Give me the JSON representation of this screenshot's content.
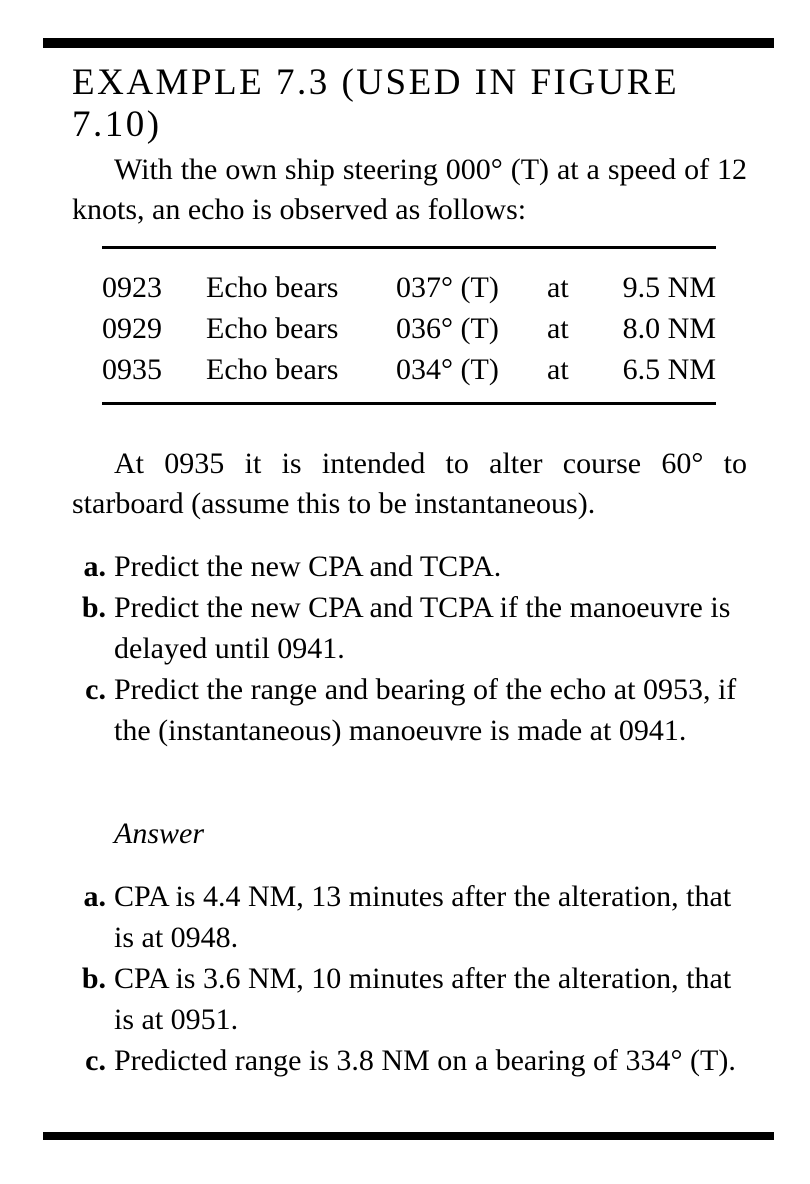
{
  "title": "EXAMPLE 7.3 (USED IN FIGURE 7.10)",
  "intro": "With the own ship steering 000° (T) at a speed of 12 knots, an echo is observed as follows:",
  "observations": [
    {
      "time": "0923",
      "label": "Echo bears",
      "bearing": "037° (T)",
      "at": "at",
      "range": "9.5 NM"
    },
    {
      "time": "0929",
      "label": "Echo bears",
      "bearing": "036° (T)",
      "at": "at",
      "range": "8.0 NM"
    },
    {
      "time": "0935",
      "label": "Echo bears",
      "bearing": "034° (T)",
      "at": "at",
      "range": "6.5 NM"
    }
  ],
  "alteration": "At 0935 it is intended to alter course 60° to starboard (assume this to be instantaneous).",
  "questions": [
    {
      "mark": "a.",
      "text": "Predict the new CPA and TCPA."
    },
    {
      "mark": "b.",
      "text": "Predict the new CPA and TCPA if the manoeuvre is delayed until 0941."
    },
    {
      "mark": "c.",
      "text": "Predict the range and bearing of the echo at 0953, if the (instantaneous) manoeuvre is made at 0941."
    }
  ],
  "answer_heading": "Answer",
  "answers": [
    {
      "mark": "a.",
      "text": "CPA is 4.4 NM, 13 minutes after the alteration, that is at 0948."
    },
    {
      "mark": "b.",
      "text": "CPA is 3.6 NM, 10 minutes after the alteration, that is at 0951."
    },
    {
      "mark": "c.",
      "text": "Predicted range is 3.8 NM on a bearing of 334° (T)."
    }
  ]
}
